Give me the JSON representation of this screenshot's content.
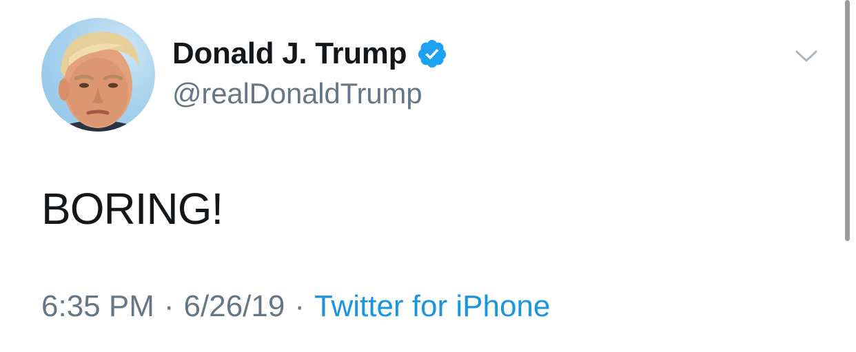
{
  "tweet": {
    "author": {
      "display_name": "Donald J. Trump",
      "handle": "@realDonaldTrump",
      "verified": true,
      "verified_color": "#1da1f2"
    },
    "text": "BORING!",
    "meta": {
      "time": "6:35 PM",
      "date": "6/26/19",
      "separator": "·",
      "source": "Twitter for iPhone",
      "source_color": "#1b95e0"
    },
    "menu_icon": "chevron-down-icon"
  }
}
